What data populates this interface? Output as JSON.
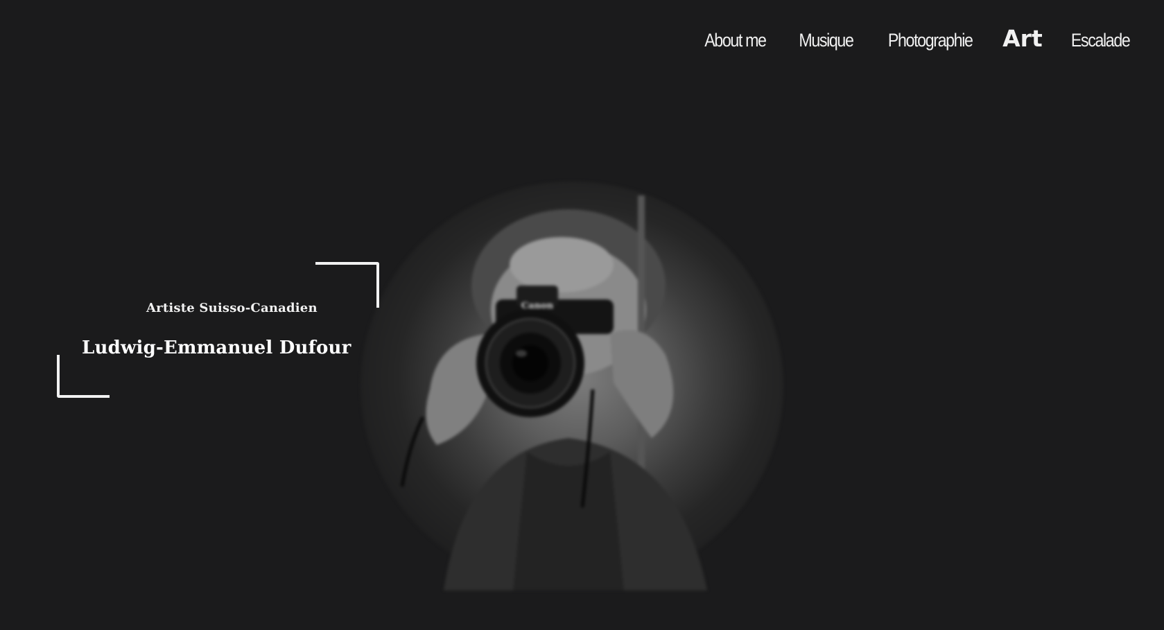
{
  "nav": {
    "items": [
      {
        "label": "About me",
        "active": false
      },
      {
        "label": "Musique",
        "active": false
      },
      {
        "label": "Photographie",
        "active": false
      },
      {
        "label": "Art",
        "active": true
      },
      {
        "label": "Escalade",
        "active": false
      }
    ]
  },
  "hero": {
    "subtitle": "Artiste Suisso-Canadien",
    "name": "Ludwig-Emmanuel Dufour",
    "camera_brand": "Canon"
  },
  "colors": {
    "background": "#1b1b1c",
    "text": "#ffffff"
  }
}
